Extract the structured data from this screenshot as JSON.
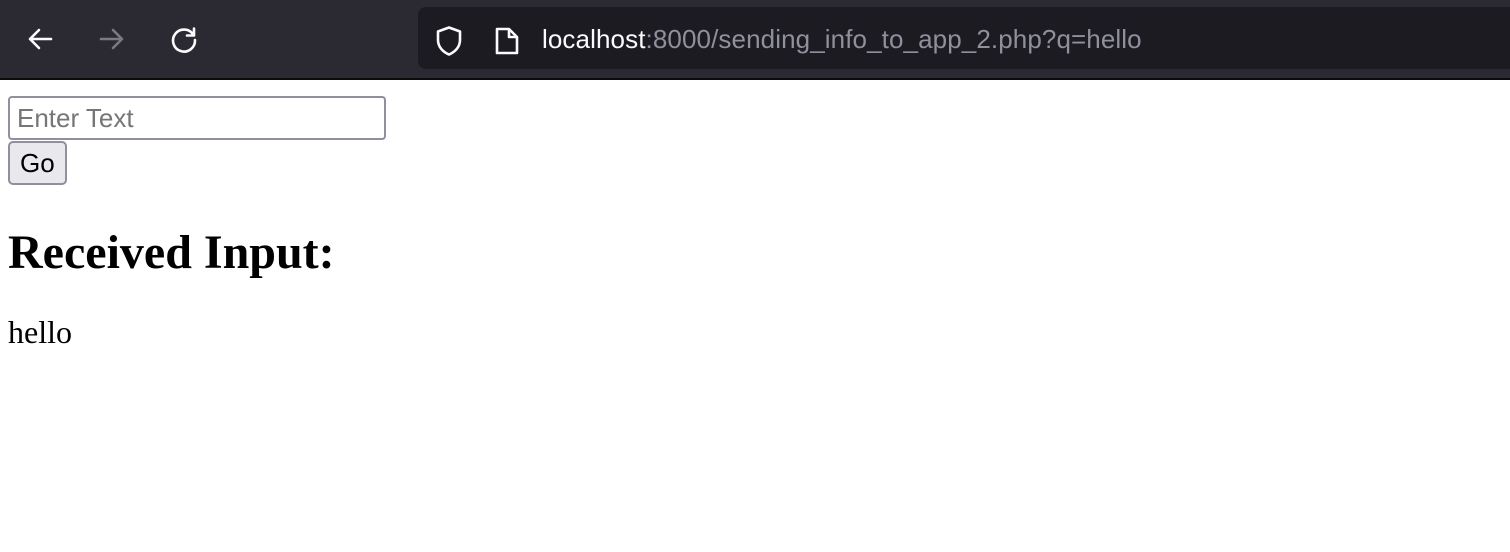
{
  "browser": {
    "url_host": "localhost",
    "url_rest": ":8000/sending_info_to_app_2.php?q=hello",
    "back_icon": "arrow-left-icon",
    "forward_icon": "arrow-right-icon",
    "reload_icon": "reload-icon",
    "security_icon": "shield-icon",
    "page_icon": "document-icon",
    "colors": {
      "toolbar_bg": "#2b2a33",
      "urlbar_bg": "#1c1b22",
      "host_text": "#fbfbfe",
      "rest_text": "#8f8f9d"
    }
  },
  "form": {
    "input_value": "",
    "input_placeholder": "Enter Text",
    "go_label": "Go"
  },
  "result": {
    "heading": "Received Input:",
    "value": "hello"
  }
}
